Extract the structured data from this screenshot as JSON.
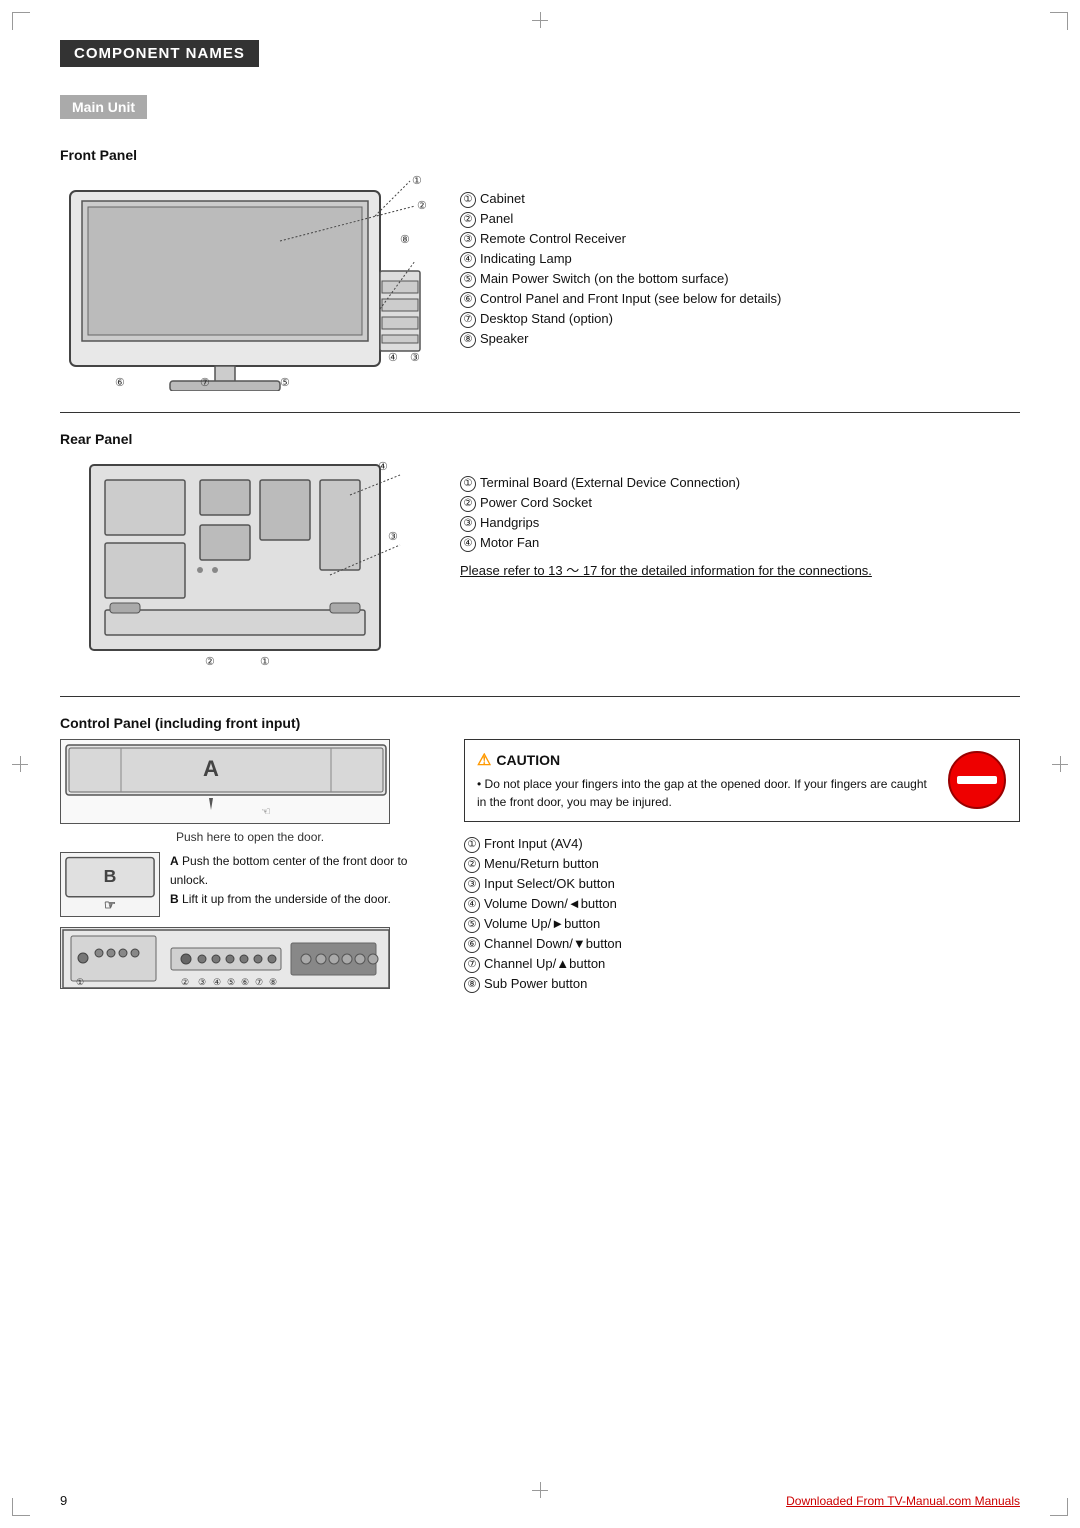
{
  "page": {
    "title": "COMPONENT NAMES",
    "subtitle": "Main Unit",
    "pageNumber": "9"
  },
  "frontPanel": {
    "heading": "Front Panel",
    "items": [
      {
        "num": "①",
        "text": "Cabinet"
      },
      {
        "num": "②",
        "text": "Panel"
      },
      {
        "num": "③",
        "text": "Remote Control Receiver"
      },
      {
        "num": "④",
        "text": "Indicating Lamp"
      },
      {
        "num": "⑤",
        "text": "Main Power Switch (on the bottom surface)"
      },
      {
        "num": "⑥",
        "text": "Control Panel and Front Input (see below for details)"
      },
      {
        "num": "⑦",
        "text": "Desktop Stand (option)"
      },
      {
        "num": "⑧",
        "text": "Speaker"
      }
    ]
  },
  "rearPanel": {
    "heading": "Rear Panel",
    "items": [
      {
        "num": "①",
        "text": "Terminal Board (External Device Connection)"
      },
      {
        "num": "②",
        "text": "Power Cord Socket"
      },
      {
        "num": "③",
        "text": "Handgrips"
      },
      {
        "num": "④",
        "text": "Motor Fan"
      }
    ],
    "referenceText": "Please refer to  13 ～ 17  for the detailed information for the connections."
  },
  "controlPanel": {
    "heading": "Control Panel (including front input)",
    "pushText": "Push here to open the door.",
    "stepA": "Push the bottom center of the front door to unlock.",
    "stepB": "Lift it up from the underside of the door.",
    "cautionTitle": "CAUTION",
    "cautionText": "• Do not place your fingers into the gap at the opened door. If your fingers are caught in the front door, you may be injured.",
    "items": [
      {
        "num": "①",
        "text": "Front Input (AV4)"
      },
      {
        "num": "②",
        "text": "Menu/Return button"
      },
      {
        "num": "③",
        "text": "Input Select/OK button"
      },
      {
        "num": "④",
        "text": "Volume Down/◄button"
      },
      {
        "num": "⑤",
        "text": "Volume Up/►button"
      },
      {
        "num": "⑥",
        "text": "Channel Down/▼button"
      },
      {
        "num": "⑦",
        "text": "Channel Up/▲button"
      },
      {
        "num": "⑧",
        "text": "Sub Power button"
      }
    ]
  },
  "footer": {
    "pageNumber": "9",
    "footerLink": "Downloaded From TV-Manual.com Manuals"
  }
}
